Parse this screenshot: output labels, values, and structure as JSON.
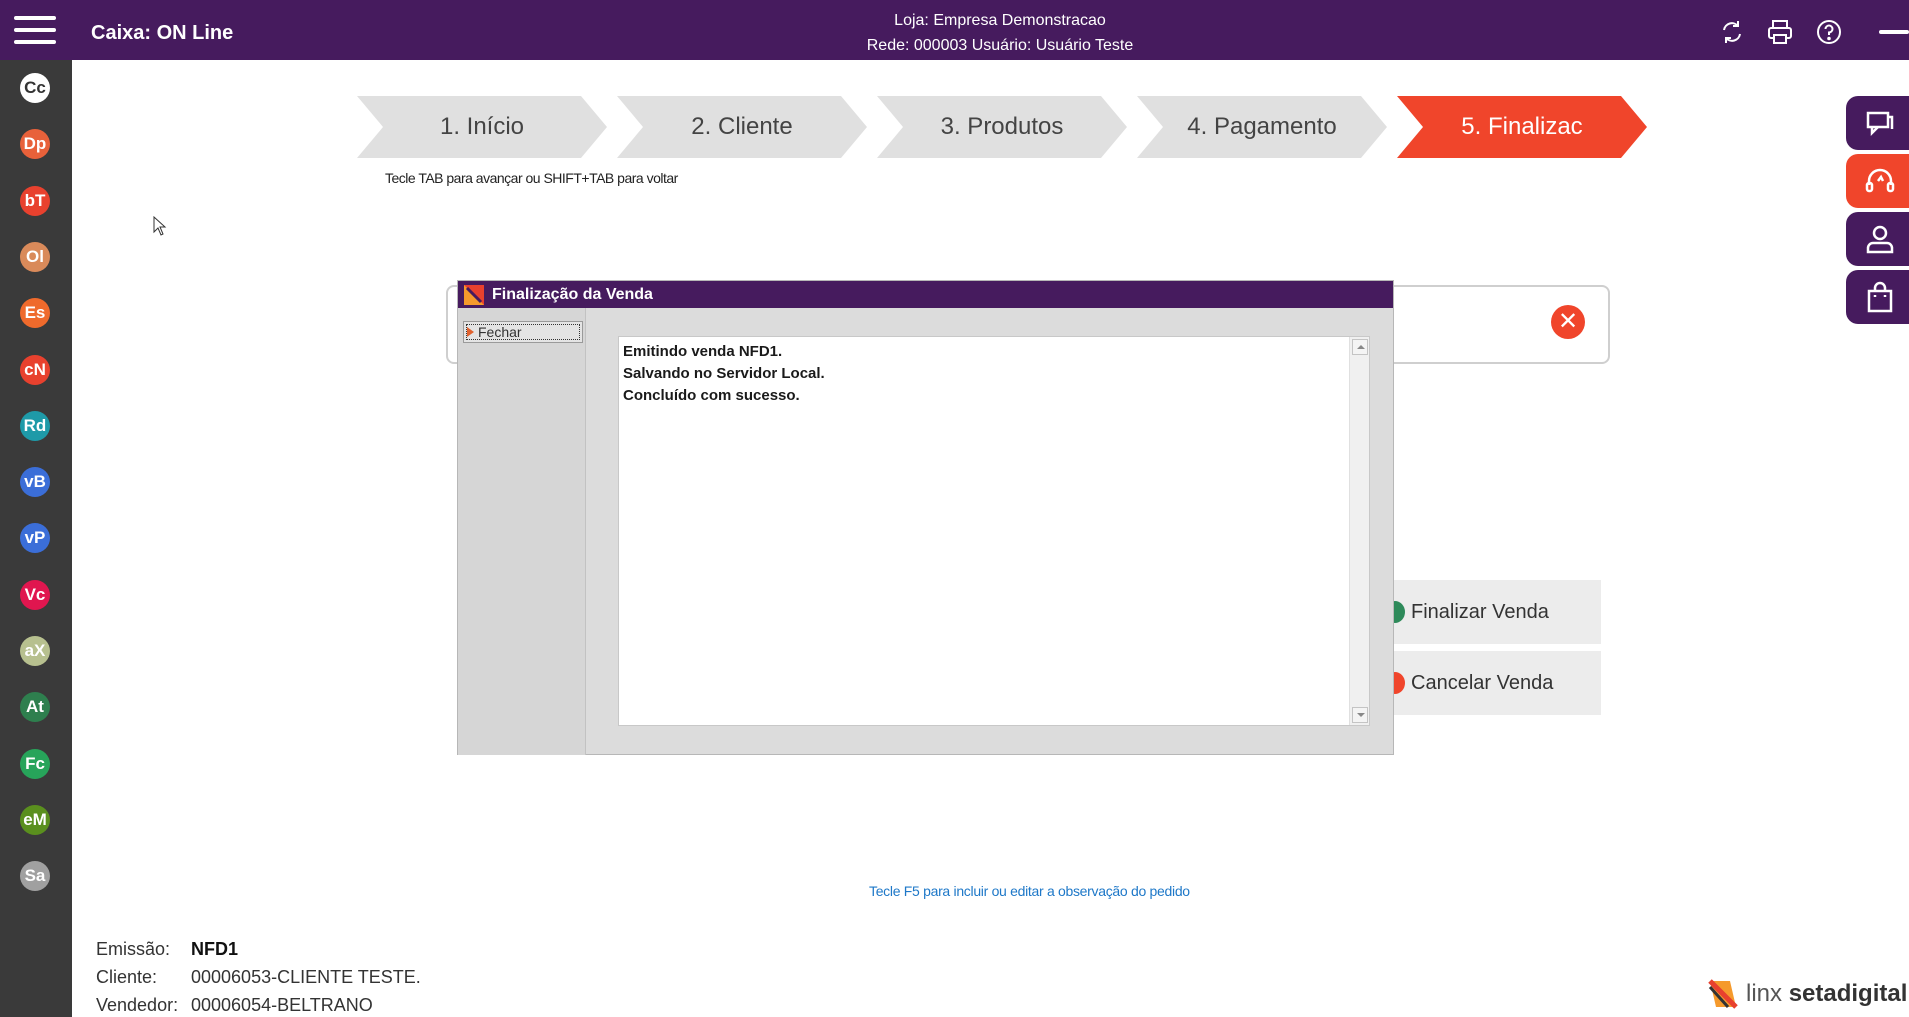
{
  "topbar": {
    "title": "Caixa: ON Line",
    "store_line": "Loja: Empresa Demonstracao",
    "network_line": "Rede: 000003 Usuário: Usuário Teste",
    "icons": [
      "sync-icon",
      "printer-icon",
      "help-icon",
      "minimize-icon"
    ]
  },
  "sidebar": {
    "items": [
      {
        "label": "Cc",
        "color": "#ffffff",
        "text": "#333333"
      },
      {
        "label": "Dp",
        "color": "#e8613a",
        "text": "#ffffff"
      },
      {
        "label": "bT",
        "color": "#e8412e",
        "text": "#ffffff"
      },
      {
        "label": "Ol",
        "color": "#d98a5a",
        "text": "#ffffff"
      },
      {
        "label": "Es",
        "color": "#ef6a2c",
        "text": "#ffffff"
      },
      {
        "label": "cN",
        "color": "#e8412e",
        "text": "#ffffff"
      },
      {
        "label": "Rd",
        "color": "#1e9aa8",
        "text": "#ffffff"
      },
      {
        "label": "vB",
        "color": "#3b6ed8",
        "text": "#ffffff"
      },
      {
        "label": "vP",
        "color": "#3b6ed8",
        "text": "#ffffff"
      },
      {
        "label": "Vc",
        "color": "#e0164f",
        "text": "#ffffff"
      },
      {
        "label": "aX",
        "color": "#b7c08f",
        "text": "#ffffff"
      },
      {
        "label": "At",
        "color": "#2e7f4e",
        "text": "#ffffff"
      },
      {
        "label": "Fc",
        "color": "#27a45a",
        "text": "#ffffff"
      },
      {
        "label": "eM",
        "color": "#5a8f1e",
        "text": "#ffffff"
      },
      {
        "label": "Sa",
        "color": "#a0a0a0",
        "text": "#ffffff"
      }
    ]
  },
  "steps": [
    {
      "label": "1. Início",
      "active": false
    },
    {
      "label": "2. Cliente",
      "active": false
    },
    {
      "label": "3. Produtos",
      "active": false
    },
    {
      "label": "4. Pagamento",
      "active": false
    },
    {
      "label": "5. Finalizac",
      "active": true
    }
  ],
  "step_hint": "Tecle TAB para avançar ou SHIFT+TAB para voltar",
  "actions": {
    "finalize": "Finalizar Venda",
    "cancel": "Cancelar Venda"
  },
  "dialog": {
    "title": "Finalização da Venda",
    "close_button": "Fechar",
    "log_lines": [
      "Emitindo venda NFD1.",
      "Salvando no Servidor Local.",
      "Concluído com sucesso."
    ]
  },
  "f5_hint": "Tecle F5 para incluir ou editar a observação do pedido",
  "footer": {
    "emissao_label": "Emissão:",
    "emissao_value": "NFD1",
    "cliente_label": "Cliente:",
    "cliente_value": "00006053-CLIENTE TESTE.",
    "vendedor_label": "Vendedor:",
    "vendedor_value": "00006054-BELTRANO"
  },
  "brand": {
    "part1": "linx ",
    "part2": "setadigital"
  },
  "colors": {
    "primary": "#461b5e",
    "accent": "#f0452b",
    "sidebar": "#3a3a3a"
  }
}
